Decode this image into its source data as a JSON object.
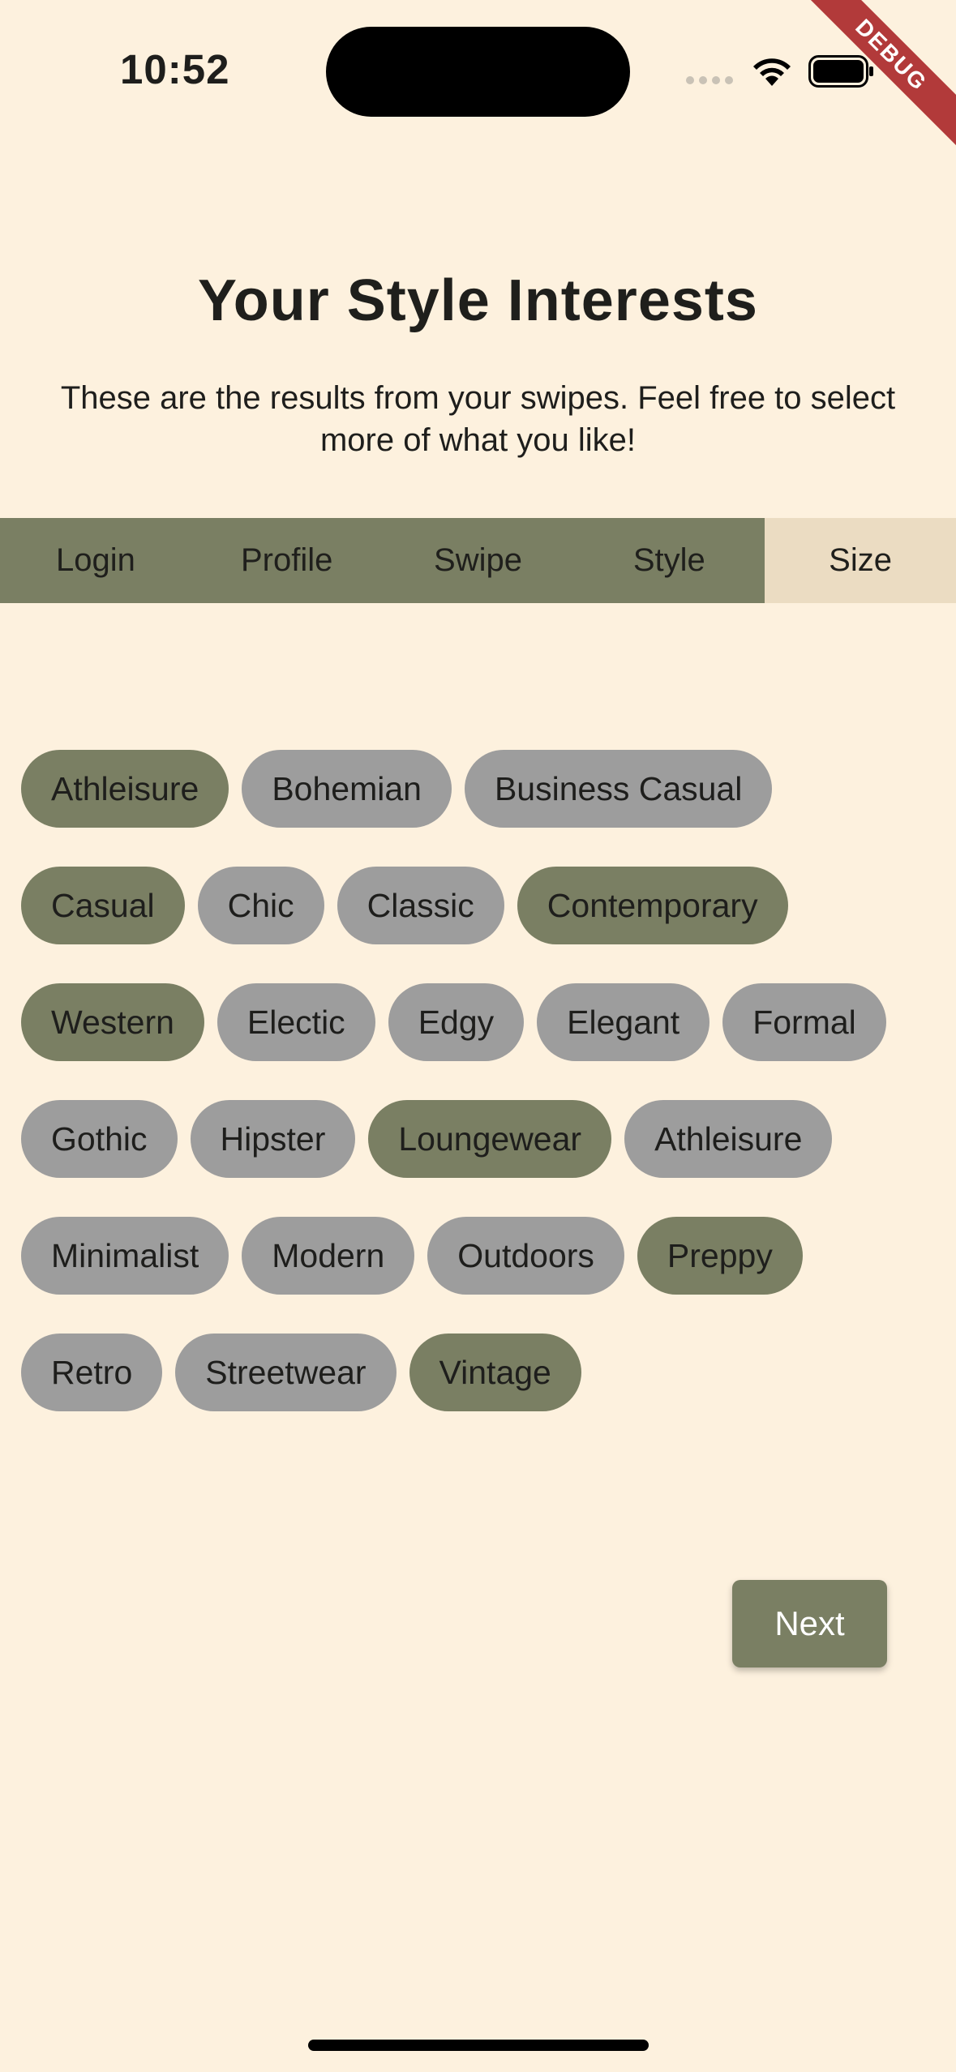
{
  "status_bar": {
    "time": "10:52"
  },
  "debug_banner": "DEBUG",
  "header": {
    "title": "Your Style Interests",
    "subtitle": "These are the results from your swipes. Feel free to select more of what you like!"
  },
  "tabs": [
    {
      "label": "Login",
      "active": false
    },
    {
      "label": "Profile",
      "active": false
    },
    {
      "label": "Swipe",
      "active": false
    },
    {
      "label": "Style",
      "active": false
    },
    {
      "label": "Size",
      "active": true
    }
  ],
  "styles": [
    {
      "label": "Athleisure",
      "selected": true
    },
    {
      "label": "Bohemian",
      "selected": false
    },
    {
      "label": "Business Casual",
      "selected": false
    },
    {
      "label": "Casual",
      "selected": true
    },
    {
      "label": "Chic",
      "selected": false
    },
    {
      "label": "Classic",
      "selected": false
    },
    {
      "label": "Contemporary",
      "selected": true
    },
    {
      "label": "Western",
      "selected": true
    },
    {
      "label": "Electic",
      "selected": false
    },
    {
      "label": "Edgy",
      "selected": false
    },
    {
      "label": "Elegant",
      "selected": false
    },
    {
      "label": "Formal",
      "selected": false
    },
    {
      "label": "Gothic",
      "selected": false
    },
    {
      "label": "Hipster",
      "selected": false
    },
    {
      "label": "Loungewear",
      "selected": true
    },
    {
      "label": "Athleisure",
      "selected": false
    },
    {
      "label": "Minimalist",
      "selected": false
    },
    {
      "label": "Modern",
      "selected": false
    },
    {
      "label": "Outdoors",
      "selected": false
    },
    {
      "label": "Preppy",
      "selected": true
    },
    {
      "label": "Retro",
      "selected": false
    },
    {
      "label": "Streetwear",
      "selected": false
    },
    {
      "label": "Vintage",
      "selected": true
    }
  ],
  "next_button": {
    "label": "Next"
  },
  "colors": {
    "background": "#FDF1DE",
    "accent": "#7A7F63",
    "chip_unselected": "#9D9D9D",
    "tab_active": "#EBDCC2"
  }
}
